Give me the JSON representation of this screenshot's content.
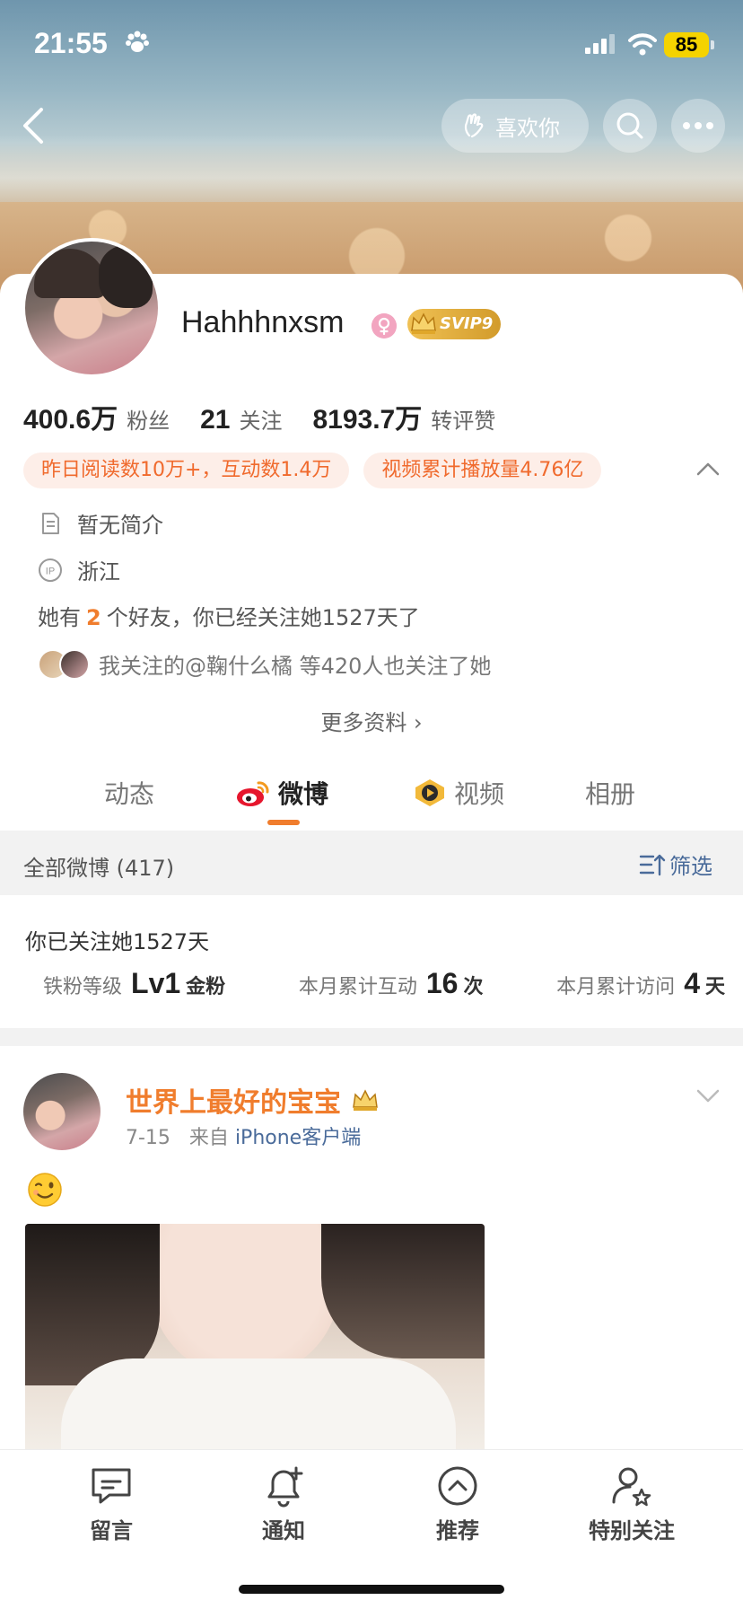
{
  "status_bar": {
    "time": "21:55",
    "battery": "85"
  },
  "header": {
    "like_label": "喜欢你"
  },
  "profile": {
    "username": "Hahhhnxsm",
    "vip_badge": "SVIP9",
    "stats": [
      {
        "value": "400.6万",
        "label": "粉丝"
      },
      {
        "value": "21",
        "label": "关注"
      },
      {
        "value": "8193.7万",
        "label": "转评赞"
      }
    ],
    "pills": [
      "昨日阅读数10万+，互动数1.4万",
      "视频累计播放量4.76亿"
    ],
    "bio": "暂无简介",
    "ip_location": "浙江",
    "friends_prefix": "她有",
    "friends_count": "2",
    "friends_suffix": "个好友，你已经关注她1527天了",
    "mutual_text": "我关注的@鞠什么橘  等420人也关注了她",
    "more_info": "更多资料 ›"
  },
  "tabs": [
    {
      "label": "动态"
    },
    {
      "label": "微博"
    },
    {
      "label": "视频"
    },
    {
      "label": "相册"
    }
  ],
  "filter_bar": {
    "count_label": "全部微博 (417)",
    "filter_label": "筛选"
  },
  "fan_card": {
    "since": "你已关注她1527天",
    "items": [
      {
        "key": "铁粉等级",
        "value": "Lv1",
        "unit": "金粉"
      },
      {
        "key": "本月累计互动",
        "value": "16",
        "unit": "次"
      },
      {
        "key": "本月累计访问",
        "value": "4",
        "unit": "天"
      }
    ]
  },
  "post": {
    "author": "世界上最好的宝宝",
    "date": "7-15",
    "source_prefix": "来自",
    "source": "iPhone客户端",
    "emoji": "wink-emoji"
  },
  "bottom_bar": [
    {
      "label": "留言",
      "icon": "message-icon"
    },
    {
      "label": "通知",
      "icon": "bell-plus-icon"
    },
    {
      "label": "推荐",
      "icon": "chevron-up-circle-icon"
    },
    {
      "label": "特别关注",
      "icon": "user-star-icon"
    }
  ],
  "colors": {
    "accent": "#f07d2d",
    "link": "#4a6b9a",
    "pill_bg": "#fdeee8"
  }
}
